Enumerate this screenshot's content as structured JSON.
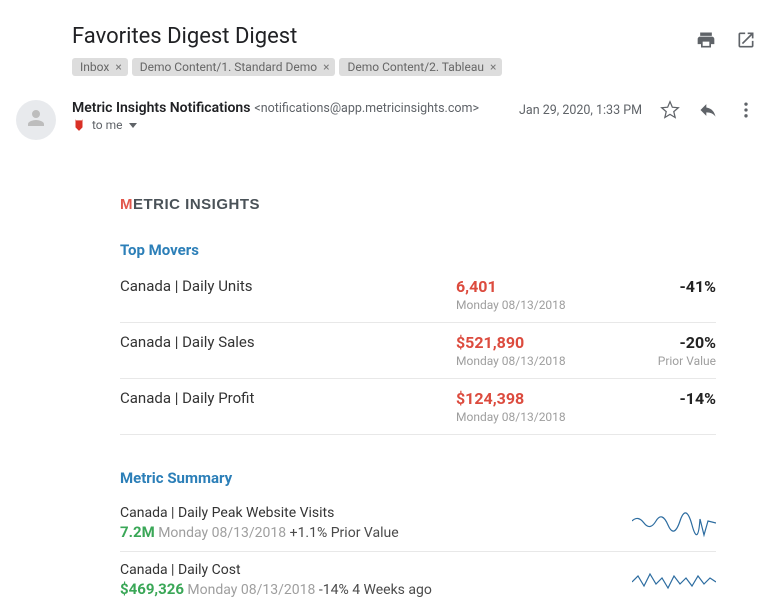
{
  "subject": "Favorites Digest Digest",
  "labels": [
    {
      "name": "Inbox"
    },
    {
      "name": "Demo Content/1. Standard Demo"
    },
    {
      "name": "Demo Content/2. Tableau"
    }
  ],
  "sender": {
    "name": "Metric Insights Notifications",
    "email": "<notifications@app.metricinsights.com>",
    "to_label": "to me"
  },
  "datetime": "Jan 29, 2020, 1:33 PM",
  "brand": {
    "m": "M",
    "etric": "ETRIC",
    "insights": " INSIGHTS"
  },
  "sections": {
    "top_movers": {
      "title": "Top Movers",
      "rows": [
        {
          "name": "Canada | Daily Units",
          "value": "6,401",
          "date": "Monday 08/13/2018",
          "pct": "-41%",
          "sub": ""
        },
        {
          "name": "Canada | Daily Sales",
          "value": "$521,890",
          "date": "Monday 08/13/2018",
          "pct": "-20%",
          "sub": "Prior Value"
        },
        {
          "name": "Canada | Daily Profit",
          "value": "$124,398",
          "date": "Monday 08/13/2018",
          "pct": "-14%",
          "sub": ""
        }
      ]
    },
    "metric_summary": {
      "title": "Metric Summary",
      "items": [
        {
          "title": "Canada | Daily Peak Website Visits",
          "value": "7.2M",
          "date": "Monday 08/13/2018",
          "delta": "+1.1% Prior Value"
        },
        {
          "title": "Canada | Daily Cost",
          "value": "$469,326",
          "date": "Monday 08/13/2018",
          "delta": "-14% 4 Weeks ago"
        }
      ]
    }
  }
}
